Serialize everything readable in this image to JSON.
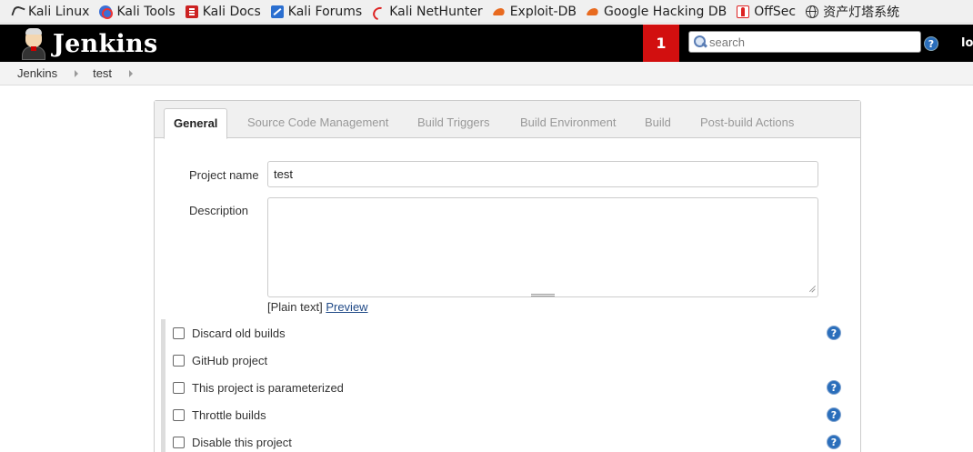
{
  "bookmarks": [
    {
      "label": "Kali Linux",
      "icon": "kali-dragon-icon"
    },
    {
      "label": "Kali Tools",
      "icon": "kali-tools-icon"
    },
    {
      "label": "Kali Docs",
      "icon": "kali-docs-icon"
    },
    {
      "label": "Kali Forums",
      "icon": "kali-forums-icon"
    },
    {
      "label": "Kali NetHunter",
      "icon": "kali-nethunter-icon"
    },
    {
      "label": "Exploit-DB",
      "icon": "exploit-db-icon"
    },
    {
      "label": "Google Hacking DB",
      "icon": "ghdb-icon"
    },
    {
      "label": "OffSec",
      "icon": "offsec-icon"
    },
    {
      "label": "资产灯塔系统",
      "icon": "globe-icon"
    }
  ],
  "header": {
    "logo_text": "Jenkins",
    "notification_count": "1",
    "search_placeholder": "search",
    "help_glyph": "?",
    "login_text": "lo",
    "bg_color": "#000000",
    "notification_color": "#d20f0f"
  },
  "breadcrumb": [
    "Jenkins",
    "test"
  ],
  "tabs": [
    {
      "label": "General",
      "active": true
    },
    {
      "label": "Source Code Management",
      "active": false
    },
    {
      "label": "Build Triggers",
      "active": false
    },
    {
      "label": "Build Environment",
      "active": false
    },
    {
      "label": "Build",
      "active": false
    },
    {
      "label": "Post-build Actions",
      "active": false
    }
  ],
  "general": {
    "project_name_label": "Project name",
    "project_name_value": "test",
    "description_label": "Description",
    "description_value": "",
    "description_hint": "[Plain text]",
    "preview_link": "Preview"
  },
  "options": [
    {
      "label": "Discard old builds",
      "checked": false,
      "help": true
    },
    {
      "label": "GitHub project",
      "checked": false,
      "help": false
    },
    {
      "label": "This project is parameterized",
      "checked": false,
      "help": true
    },
    {
      "label": "Throttle builds",
      "checked": false,
      "help": true
    },
    {
      "label": "Disable this project",
      "checked": false,
      "help": true
    }
  ],
  "help_glyph": "?"
}
